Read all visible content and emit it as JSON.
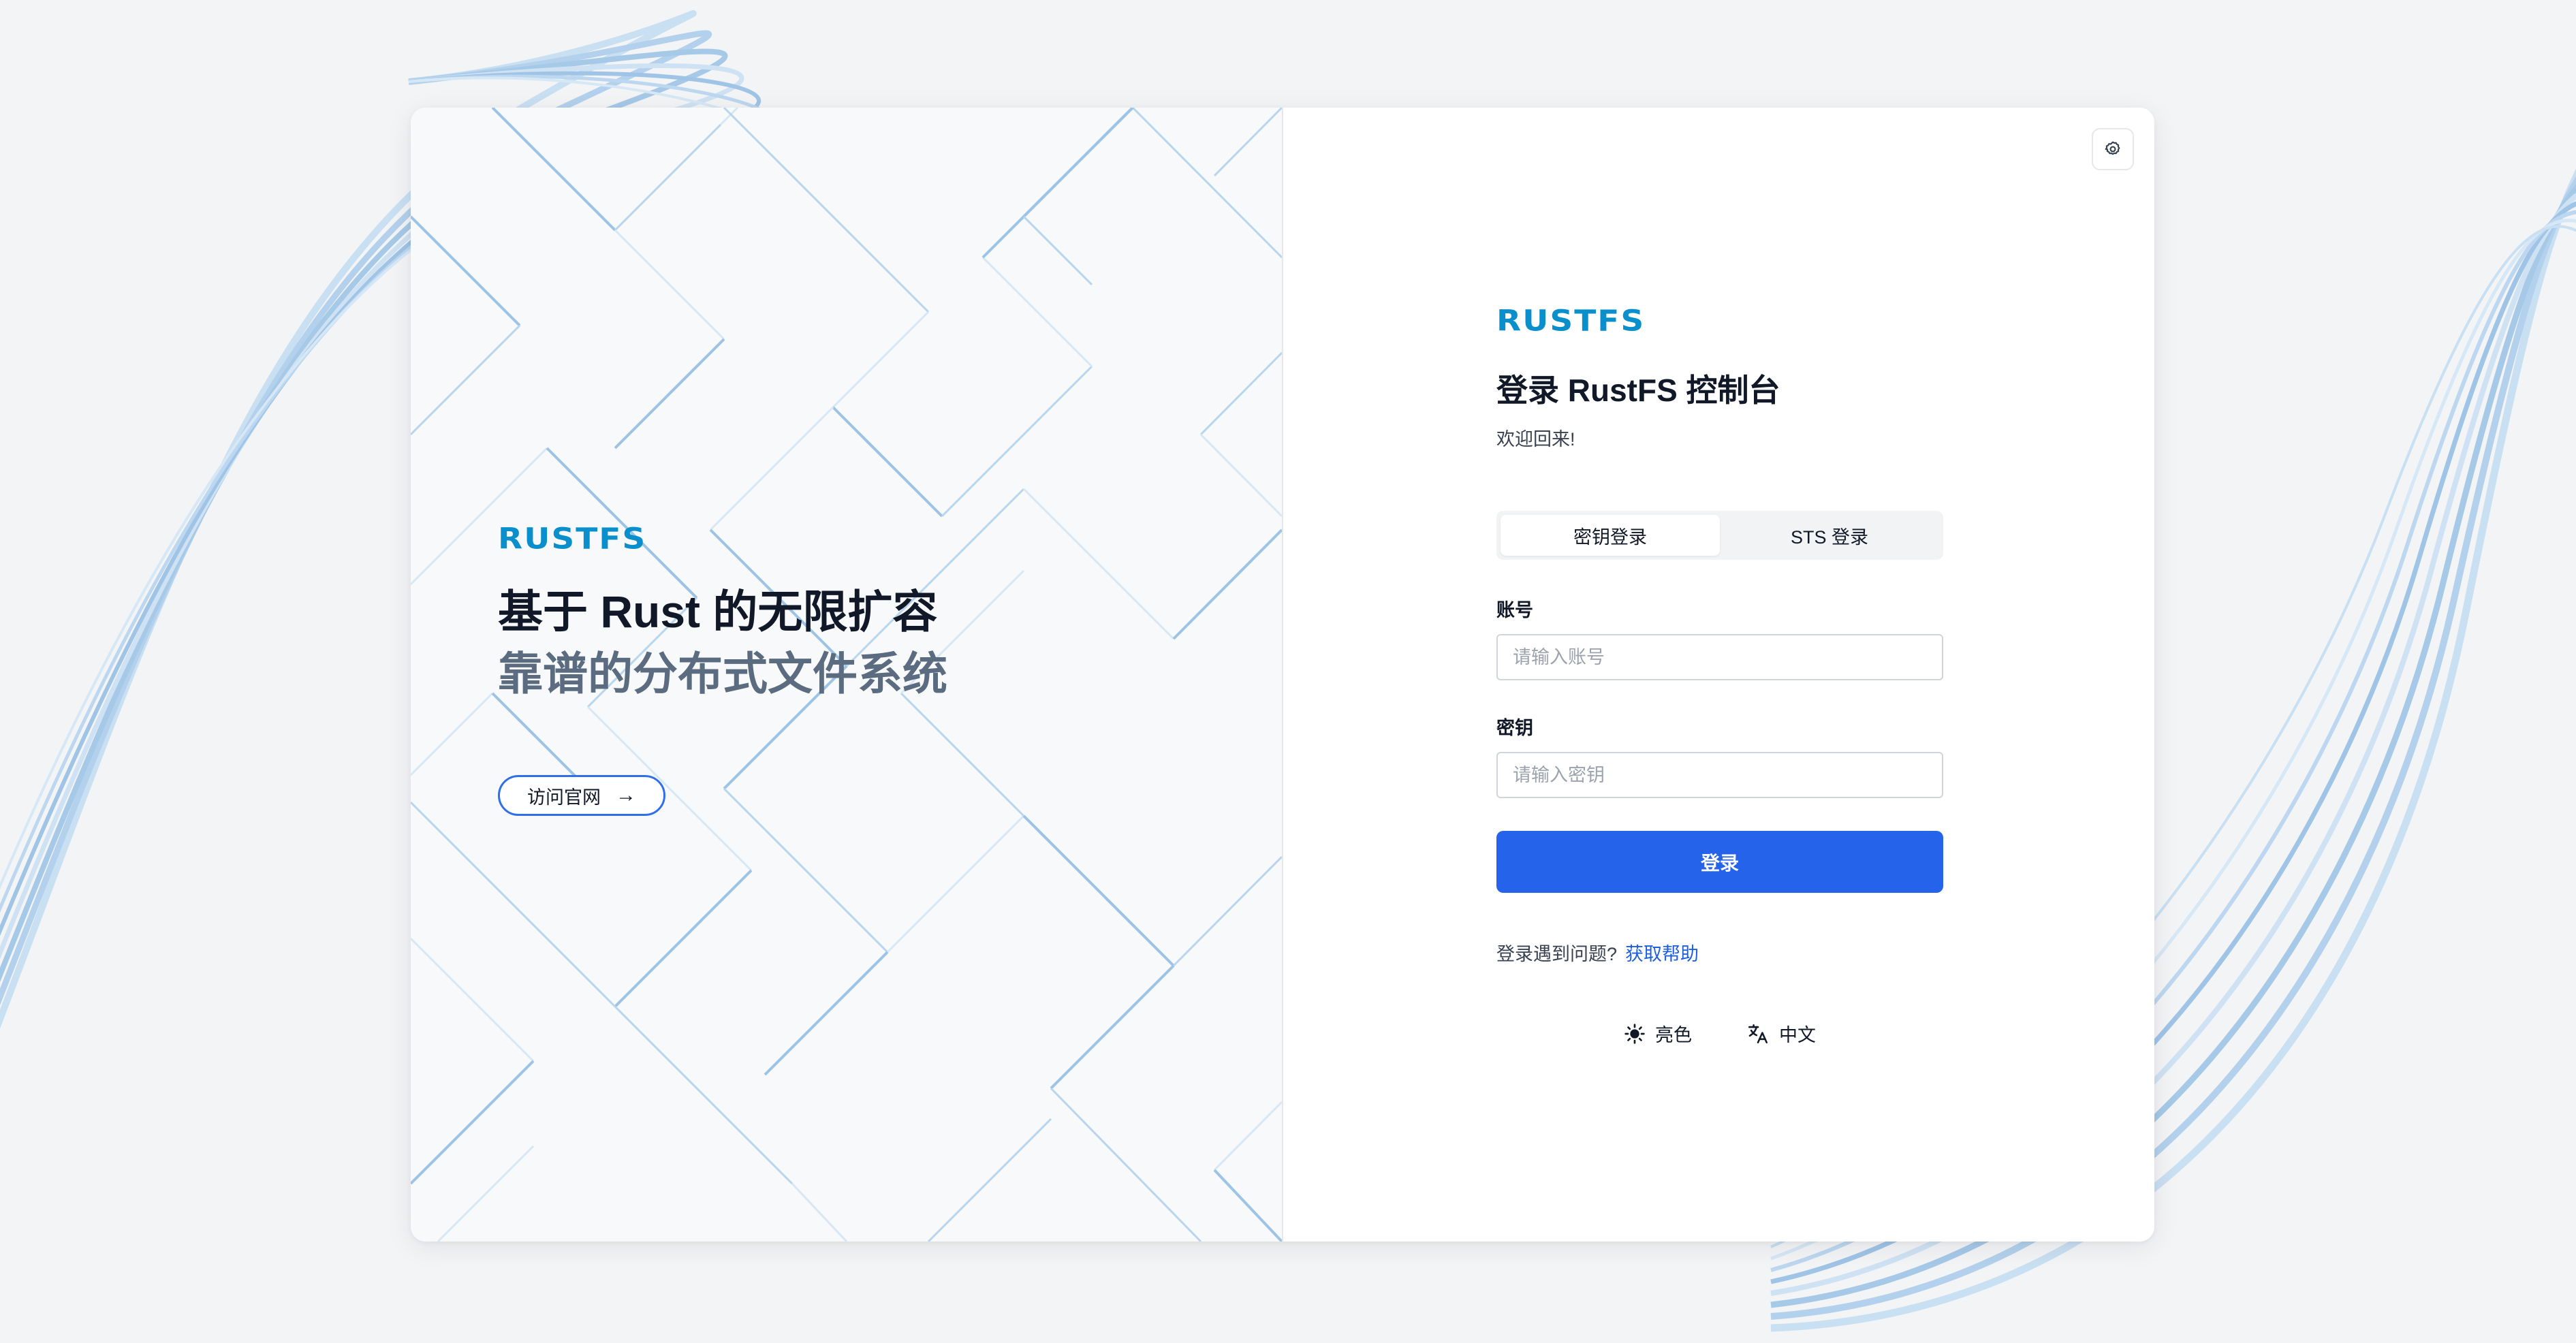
{
  "brand": {
    "logo_text": "RUSTFS",
    "logo_color": "#0a8fcd"
  },
  "hero": {
    "title": "基于 Rust 的无限扩容",
    "subtitle": "靠谱的分布式文件系统",
    "visit_button_label": "访问官网",
    "visit_button_arrow": "→"
  },
  "login": {
    "title": "登录 RustFS 控制台",
    "welcome": "欢迎回来!",
    "tabs": [
      {
        "label": "密钥登录",
        "active": true
      },
      {
        "label": "STS 登录",
        "active": false
      }
    ],
    "account": {
      "label": "账号",
      "placeholder": "请输入账号",
      "value": ""
    },
    "secret": {
      "label": "密钥",
      "placeholder": "请输入密钥",
      "value": ""
    },
    "submit_label": "登录",
    "help_text": "登录遇到问题?",
    "help_link": "获取帮助",
    "theme_label": "亮色",
    "language_label": "中文"
  },
  "icons": {
    "settings": "gear-icon",
    "theme": "sun-icon",
    "language": "translate-icon",
    "visit": "arrow-right-icon"
  },
  "colors": {
    "page_bg": "#f3f4f6",
    "primary": "#2563eb",
    "link": "#1d5fe0",
    "muted_heading": "#5b6b80",
    "pattern_line": "#9dc3e6"
  }
}
